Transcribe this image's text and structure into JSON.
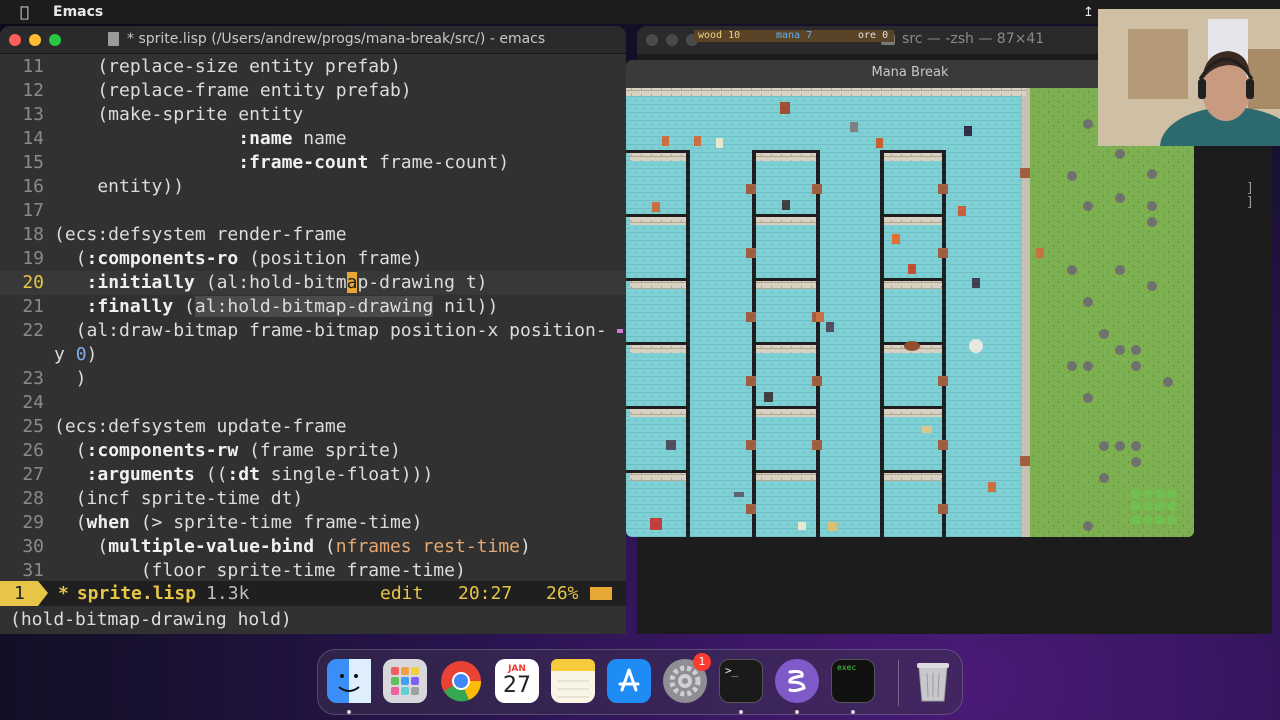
{
  "menubar": {
    "apple": "",
    "app_name": "Emacs"
  },
  "emacs": {
    "title": "* sprite.lisp (/Users/andrew/progs/mana-break/src/) - emacs",
    "lines": [
      {
        "num": "11",
        "text": "    (replace-size entity prefab)"
      },
      {
        "num": "12",
        "text": "    (replace-frame entity prefab)"
      },
      {
        "num": "13",
        "text": "    (make-sprite entity"
      },
      {
        "num": "14",
        "text": "                 :name name"
      },
      {
        "num": "15",
        "text": "                 :frame-count frame-count)"
      },
      {
        "num": "16",
        "text": "    entity))"
      },
      {
        "num": "17",
        "text": ""
      },
      {
        "num": "18",
        "text": "(ecs:defsystem render-frame"
      },
      {
        "num": "19",
        "text": "  (:components-ro (position frame)"
      },
      {
        "num": "20",
        "text": "   :initially (al:hold-bitmap-drawing t)"
      },
      {
        "num": "21",
        "text": "   :finally (al:hold-bitmap-drawing nil))"
      },
      {
        "num": "22",
        "text": "  (al:draw-bitmap frame-bitmap position-x position-"
      },
      {
        "num": "",
        "text": "y 0)"
      },
      {
        "num": "23",
        "text": "  )"
      },
      {
        "num": "24",
        "text": ""
      },
      {
        "num": "25",
        "text": "(ecs:defsystem update-frame"
      },
      {
        "num": "26",
        "text": "  (:components-rw (frame sprite)"
      },
      {
        "num": "27",
        "text": "   :arguments ((:dt single-float)))"
      },
      {
        "num": "28",
        "text": "  (incf sprite-time dt)"
      },
      {
        "num": "29",
        "text": "  (when (> sprite-time frame-time)"
      },
      {
        "num": "30",
        "text": "    (multiple-value-bind (nframes rest-time)"
      },
      {
        "num": "31",
        "text": "        (floor sprite-time frame-time)"
      }
    ],
    "modeline": {
      "window_num": "1",
      "modified": "*",
      "file": "sprite.lisp",
      "size": "1.3k",
      "mode": "edit",
      "position": "20:27",
      "percent": "26%"
    },
    "minibuffer": "(hold-bitmap-drawing hold)"
  },
  "terminal": {
    "title": "src — -zsh — 87×41"
  },
  "game": {
    "title": "Mana Break",
    "hud": {
      "wood": "wood 10",
      "mana": "mana 7",
      "ore": "ore 0"
    }
  },
  "dock": {
    "calendar_month": "JAN",
    "calendar_day": "27",
    "settings_badge": "1",
    "exec_label": "exec",
    "terminal_prompt": ">_"
  }
}
